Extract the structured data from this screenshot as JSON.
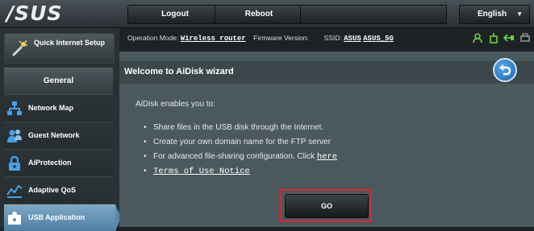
{
  "header": {
    "logo": "/SUS",
    "logout_label": "Logout",
    "reboot_label": "Reboot",
    "language": "English",
    "language_caret": "▼"
  },
  "sidebar": {
    "quick_setup_label": "Quick Internet Setup",
    "section_title": "General",
    "items": [
      {
        "label": "Network Map",
        "icon": "network-map-icon"
      },
      {
        "label": "Guest Network",
        "icon": "guest-network-icon"
      },
      {
        "label": "AiProtection",
        "icon": "lock-icon"
      },
      {
        "label": "Adaptive QoS",
        "icon": "qos-chart-icon"
      },
      {
        "label": "USB Application",
        "icon": "puzzle-icon",
        "active": true
      }
    ]
  },
  "infobar": {
    "mode_label": "Operation Mode:",
    "mode_value": "Wireless router",
    "firmware_label": "Firmware Version:",
    "ssid_label": "SSID:",
    "ssid_1": "ASUS",
    "ssid_2": "ASUS_5G",
    "status_icons": [
      "user-icon",
      "usb-icon",
      "network-icon",
      "printer-icon"
    ]
  },
  "panel": {
    "title": "Welcome to AiDisk wizard",
    "intro": "AiDisk enables you to:",
    "bullets": [
      "Share files in the USB disk through the Internet.",
      "Create your own domain name for the FTP server",
      "For advanced file-sharing configuration. Click"
    ],
    "here_link": "here",
    "terms_link": "Terms of Use Notice",
    "bullet_glyph": "•",
    "go_label": "GO"
  },
  "colors": {
    "highlight_border": "#e0242a",
    "active_nav": "#6895b6",
    "back_button": "#2f86d4"
  }
}
